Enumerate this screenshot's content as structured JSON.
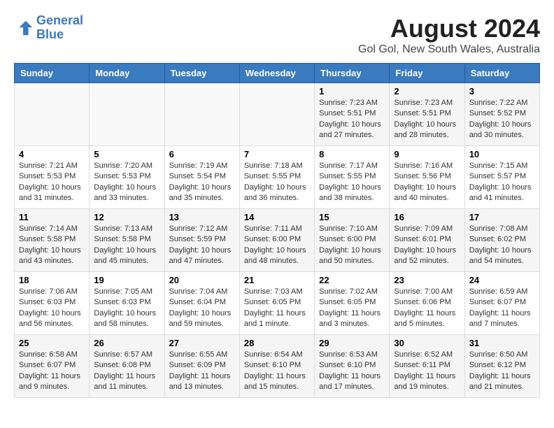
{
  "logo": {
    "line1": "General",
    "line2": "Blue"
  },
  "title": "August 2024",
  "subtitle": "Gol Gol, New South Wales, Australia",
  "days_of_week": [
    "Sunday",
    "Monday",
    "Tuesday",
    "Wednesday",
    "Thursday",
    "Friday",
    "Saturday"
  ],
  "weeks": [
    [
      {
        "day": "",
        "info": ""
      },
      {
        "day": "",
        "info": ""
      },
      {
        "day": "",
        "info": ""
      },
      {
        "day": "",
        "info": ""
      },
      {
        "day": "1",
        "info": "Sunrise: 7:23 AM\nSunset: 5:51 PM\nDaylight: 10 hours\nand 27 minutes."
      },
      {
        "day": "2",
        "info": "Sunrise: 7:23 AM\nSunset: 5:51 PM\nDaylight: 10 hours\nand 28 minutes."
      },
      {
        "day": "3",
        "info": "Sunrise: 7:22 AM\nSunset: 5:52 PM\nDaylight: 10 hours\nand 30 minutes."
      }
    ],
    [
      {
        "day": "4",
        "info": "Sunrise: 7:21 AM\nSunset: 5:53 PM\nDaylight: 10 hours\nand 31 minutes."
      },
      {
        "day": "5",
        "info": "Sunrise: 7:20 AM\nSunset: 5:53 PM\nDaylight: 10 hours\nand 33 minutes."
      },
      {
        "day": "6",
        "info": "Sunrise: 7:19 AM\nSunset: 5:54 PM\nDaylight: 10 hours\nand 35 minutes."
      },
      {
        "day": "7",
        "info": "Sunrise: 7:18 AM\nSunset: 5:55 PM\nDaylight: 10 hours\nand 36 minutes."
      },
      {
        "day": "8",
        "info": "Sunrise: 7:17 AM\nSunset: 5:55 PM\nDaylight: 10 hours\nand 38 minutes."
      },
      {
        "day": "9",
        "info": "Sunrise: 7:16 AM\nSunset: 5:56 PM\nDaylight: 10 hours\nand 40 minutes."
      },
      {
        "day": "10",
        "info": "Sunrise: 7:15 AM\nSunset: 5:57 PM\nDaylight: 10 hours\nand 41 minutes."
      }
    ],
    [
      {
        "day": "11",
        "info": "Sunrise: 7:14 AM\nSunset: 5:58 PM\nDaylight: 10 hours\nand 43 minutes."
      },
      {
        "day": "12",
        "info": "Sunrise: 7:13 AM\nSunset: 5:58 PM\nDaylight: 10 hours\nand 45 minutes."
      },
      {
        "day": "13",
        "info": "Sunrise: 7:12 AM\nSunset: 5:59 PM\nDaylight: 10 hours\nand 47 minutes."
      },
      {
        "day": "14",
        "info": "Sunrise: 7:11 AM\nSunset: 6:00 PM\nDaylight: 10 hours\nand 48 minutes."
      },
      {
        "day": "15",
        "info": "Sunrise: 7:10 AM\nSunset: 6:00 PM\nDaylight: 10 hours\nand 50 minutes."
      },
      {
        "day": "16",
        "info": "Sunrise: 7:09 AM\nSunset: 6:01 PM\nDaylight: 10 hours\nand 52 minutes."
      },
      {
        "day": "17",
        "info": "Sunrise: 7:08 AM\nSunset: 6:02 PM\nDaylight: 10 hours\nand 54 minutes."
      }
    ],
    [
      {
        "day": "18",
        "info": "Sunrise: 7:06 AM\nSunset: 6:03 PM\nDaylight: 10 hours\nand 56 minutes."
      },
      {
        "day": "19",
        "info": "Sunrise: 7:05 AM\nSunset: 6:03 PM\nDaylight: 10 hours\nand 58 minutes."
      },
      {
        "day": "20",
        "info": "Sunrise: 7:04 AM\nSunset: 6:04 PM\nDaylight: 10 hours\nand 59 minutes."
      },
      {
        "day": "21",
        "info": "Sunrise: 7:03 AM\nSunset: 6:05 PM\nDaylight: 11 hours\nand 1 minute."
      },
      {
        "day": "22",
        "info": "Sunrise: 7:02 AM\nSunset: 6:05 PM\nDaylight: 11 hours\nand 3 minutes."
      },
      {
        "day": "23",
        "info": "Sunrise: 7:00 AM\nSunset: 6:06 PM\nDaylight: 11 hours\nand 5 minutes."
      },
      {
        "day": "24",
        "info": "Sunrise: 6:59 AM\nSunset: 6:07 PM\nDaylight: 11 hours\nand 7 minutes."
      }
    ],
    [
      {
        "day": "25",
        "info": "Sunrise: 6:58 AM\nSunset: 6:07 PM\nDaylight: 11 hours\nand 9 minutes."
      },
      {
        "day": "26",
        "info": "Sunrise: 6:57 AM\nSunset: 6:08 PM\nDaylight: 11 hours\nand 11 minutes."
      },
      {
        "day": "27",
        "info": "Sunrise: 6:55 AM\nSunset: 6:09 PM\nDaylight: 11 hours\nand 13 minutes."
      },
      {
        "day": "28",
        "info": "Sunrise: 6:54 AM\nSunset: 6:10 PM\nDaylight: 11 hours\nand 15 minutes."
      },
      {
        "day": "29",
        "info": "Sunrise: 6:53 AM\nSunset: 6:10 PM\nDaylight: 11 hours\nand 17 minutes."
      },
      {
        "day": "30",
        "info": "Sunrise: 6:52 AM\nSunset: 6:11 PM\nDaylight: 11 hours\nand 19 minutes."
      },
      {
        "day": "31",
        "info": "Sunrise: 6:50 AM\nSunset: 6:12 PM\nDaylight: 11 hours\nand 21 minutes."
      }
    ]
  ]
}
